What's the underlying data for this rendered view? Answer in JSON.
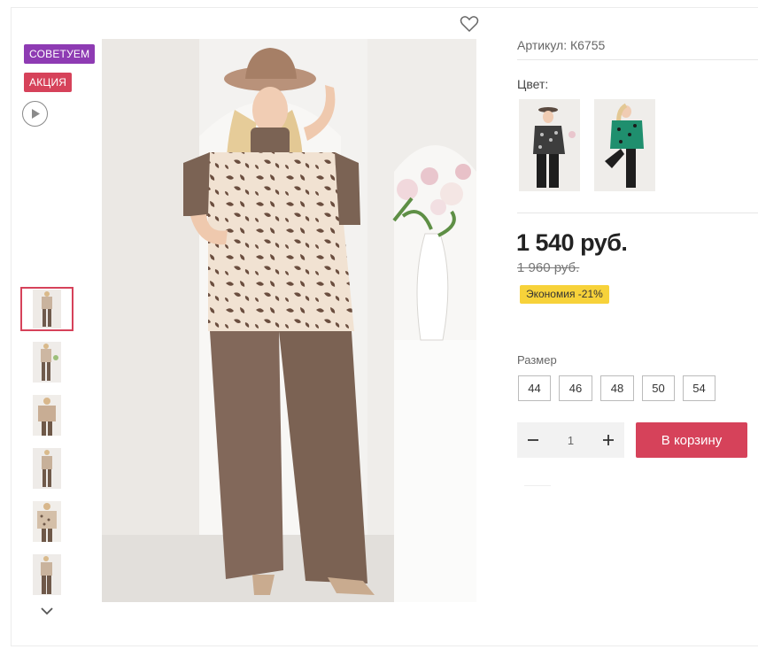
{
  "badges": {
    "recommend": "СОВЕТУЕМ",
    "promo": "АКЦИЯ"
  },
  "icons": {
    "play": "play-icon",
    "favorite": "heart-outline-icon",
    "scroll_down": "chevron-down-icon",
    "minus": "minus-icon",
    "plus": "plus-icon"
  },
  "gallery": {
    "thumbnail_count": 6,
    "active_thumbnail": 1
  },
  "product": {
    "article": "Артикул: К6755",
    "color_label": "Цвет:",
    "price": "1 540 руб.",
    "old_price": "1 960 руб.",
    "savings": "Экономия -21%",
    "size_label": "Размер",
    "sizes": [
      "44",
      "46",
      "48",
      "50",
      "54"
    ],
    "quantity": "1",
    "add_to_cart": "В корзину"
  },
  "colors": {
    "accent": "#d6425a",
    "badge_recommend": "#8e3bb3",
    "savings_bg": "#f7d23a",
    "price_text": "#222222"
  }
}
